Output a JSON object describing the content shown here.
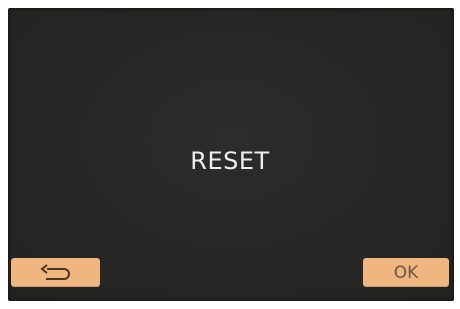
{
  "screen": {
    "message": "RESET"
  },
  "softkeys": {
    "back": {
      "icon": "return-arrow-icon"
    },
    "ok": {
      "label": "OK"
    }
  },
  "colors": {
    "screen_background": "#272726",
    "softkey_background": "#f0b680",
    "message_text": "#eeeeee"
  }
}
